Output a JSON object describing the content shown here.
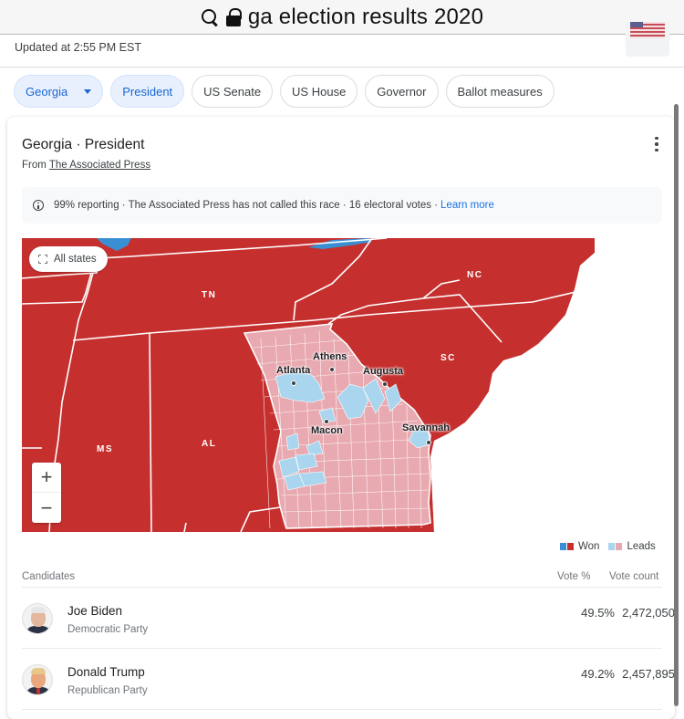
{
  "browser": {
    "url_text": "ga election results 2020",
    "icons": [
      "search-icon",
      "lock-icon"
    ]
  },
  "header": {
    "updated": "Updated at 2:55 PM EST",
    "flag_icon": "us-flag-icon"
  },
  "filters": {
    "chips": [
      {
        "label": "Georgia",
        "active": true,
        "dropdown": true
      },
      {
        "label": "President",
        "active": true
      },
      {
        "label": "US Senate",
        "active": false
      },
      {
        "label": "US House",
        "active": false
      },
      {
        "label": "Governor",
        "active": false
      },
      {
        "label": "Ballot measures",
        "active": false
      }
    ]
  },
  "card": {
    "title": "Georgia · President",
    "source_prefix": "From",
    "source_name": "The Associated Press",
    "info": {
      "text": "99% reporting · The Associated Press has not called this race · 16 electoral votes · ",
      "link": "Learn more"
    },
    "map": {
      "all_states_label": "All states",
      "zoom_in": "+",
      "zoom_out": "−",
      "states": {
        "tn": "TN",
        "nc": "NC",
        "sc": "SC",
        "ms": "MS",
        "al": "AL"
      },
      "cities": {
        "atlanta": "Atlanta",
        "athens": "Athens",
        "augusta": "Augusta",
        "macon": "Macon",
        "savannah": "Savannah"
      },
      "colors": {
        "rep_won": "#c5302f",
        "rep_leads": "#e8a9b0",
        "dem_won": "#3a8fd4",
        "dem_leads": "#a9d6ee"
      }
    },
    "legend": {
      "won": "Won",
      "leads": "Leads"
    },
    "table": {
      "headers": {
        "candidates": "Candidates",
        "vote_pct": "Vote %",
        "vote_count": "Vote count"
      },
      "rows": [
        {
          "name": "Joe Biden",
          "party": "Democratic Party",
          "vote_pct": "49.5%",
          "vote_count": "2,472,050"
        },
        {
          "name": "Donald Trump",
          "party": "Republican Party",
          "vote_pct": "49.2%",
          "vote_count": "2,457,895"
        }
      ]
    }
  }
}
